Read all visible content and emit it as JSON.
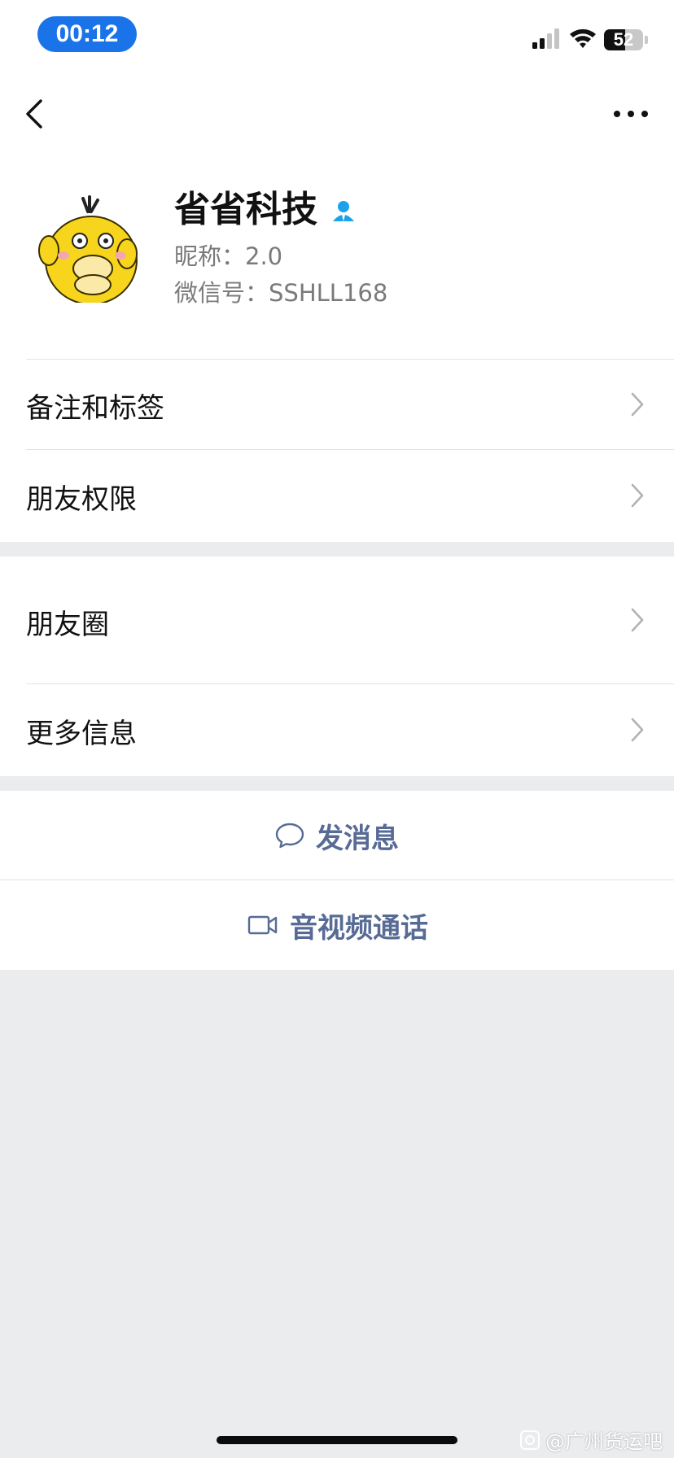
{
  "status_bar": {
    "time": "00:12",
    "battery": "52"
  },
  "profile": {
    "name": "省省科技",
    "nickname_label": "昵称：",
    "nickname": "2.0",
    "wechat_id_label": "微信号：",
    "wechat_id": "SSHLL168"
  },
  "rows": {
    "remark_tags": "备注和标签",
    "friend_permissions": "朋友权限",
    "moments": "朋友圈",
    "more_info": "更多信息"
  },
  "actions": {
    "send_message": "发消息",
    "video_call": "音视频通话"
  },
  "watermark": "@广州货运吧",
  "colors": {
    "time_pill": "#1a73e8",
    "action_text": "#576b95",
    "verified_icon": "#1aa3e8",
    "page_bg": "#ebeced"
  },
  "icons": {
    "back": "chevron-left-icon",
    "more": "more-dots-icon",
    "verified": "verified-user-icon",
    "message": "chat-bubble-icon",
    "video": "video-camera-icon"
  }
}
